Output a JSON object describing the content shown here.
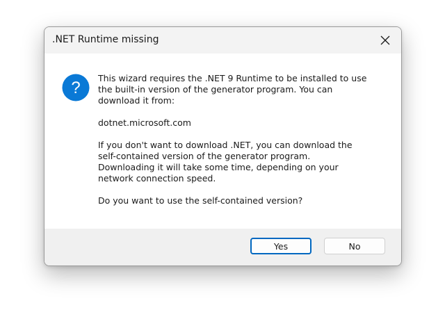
{
  "dialog": {
    "title": ".NET Runtime missing",
    "close_icon": "close-icon",
    "icon": "question-icon",
    "accent_color": "#0a79d6",
    "message": [
      "This wizard requires the .NET 9 Runtime to be installed to use\nthe built-in version of the generator program. You can\ndownload it from:",
      "dotnet.microsoft.com",
      "If you don't want to download .NET, you can download the\nself-contained version of the generator program.\nDownloading it will take some time, depending on your\nnetwork connection speed.",
      "Do you want to use the self-contained version?"
    ],
    "buttons": {
      "yes": "Yes",
      "no": "No"
    }
  }
}
